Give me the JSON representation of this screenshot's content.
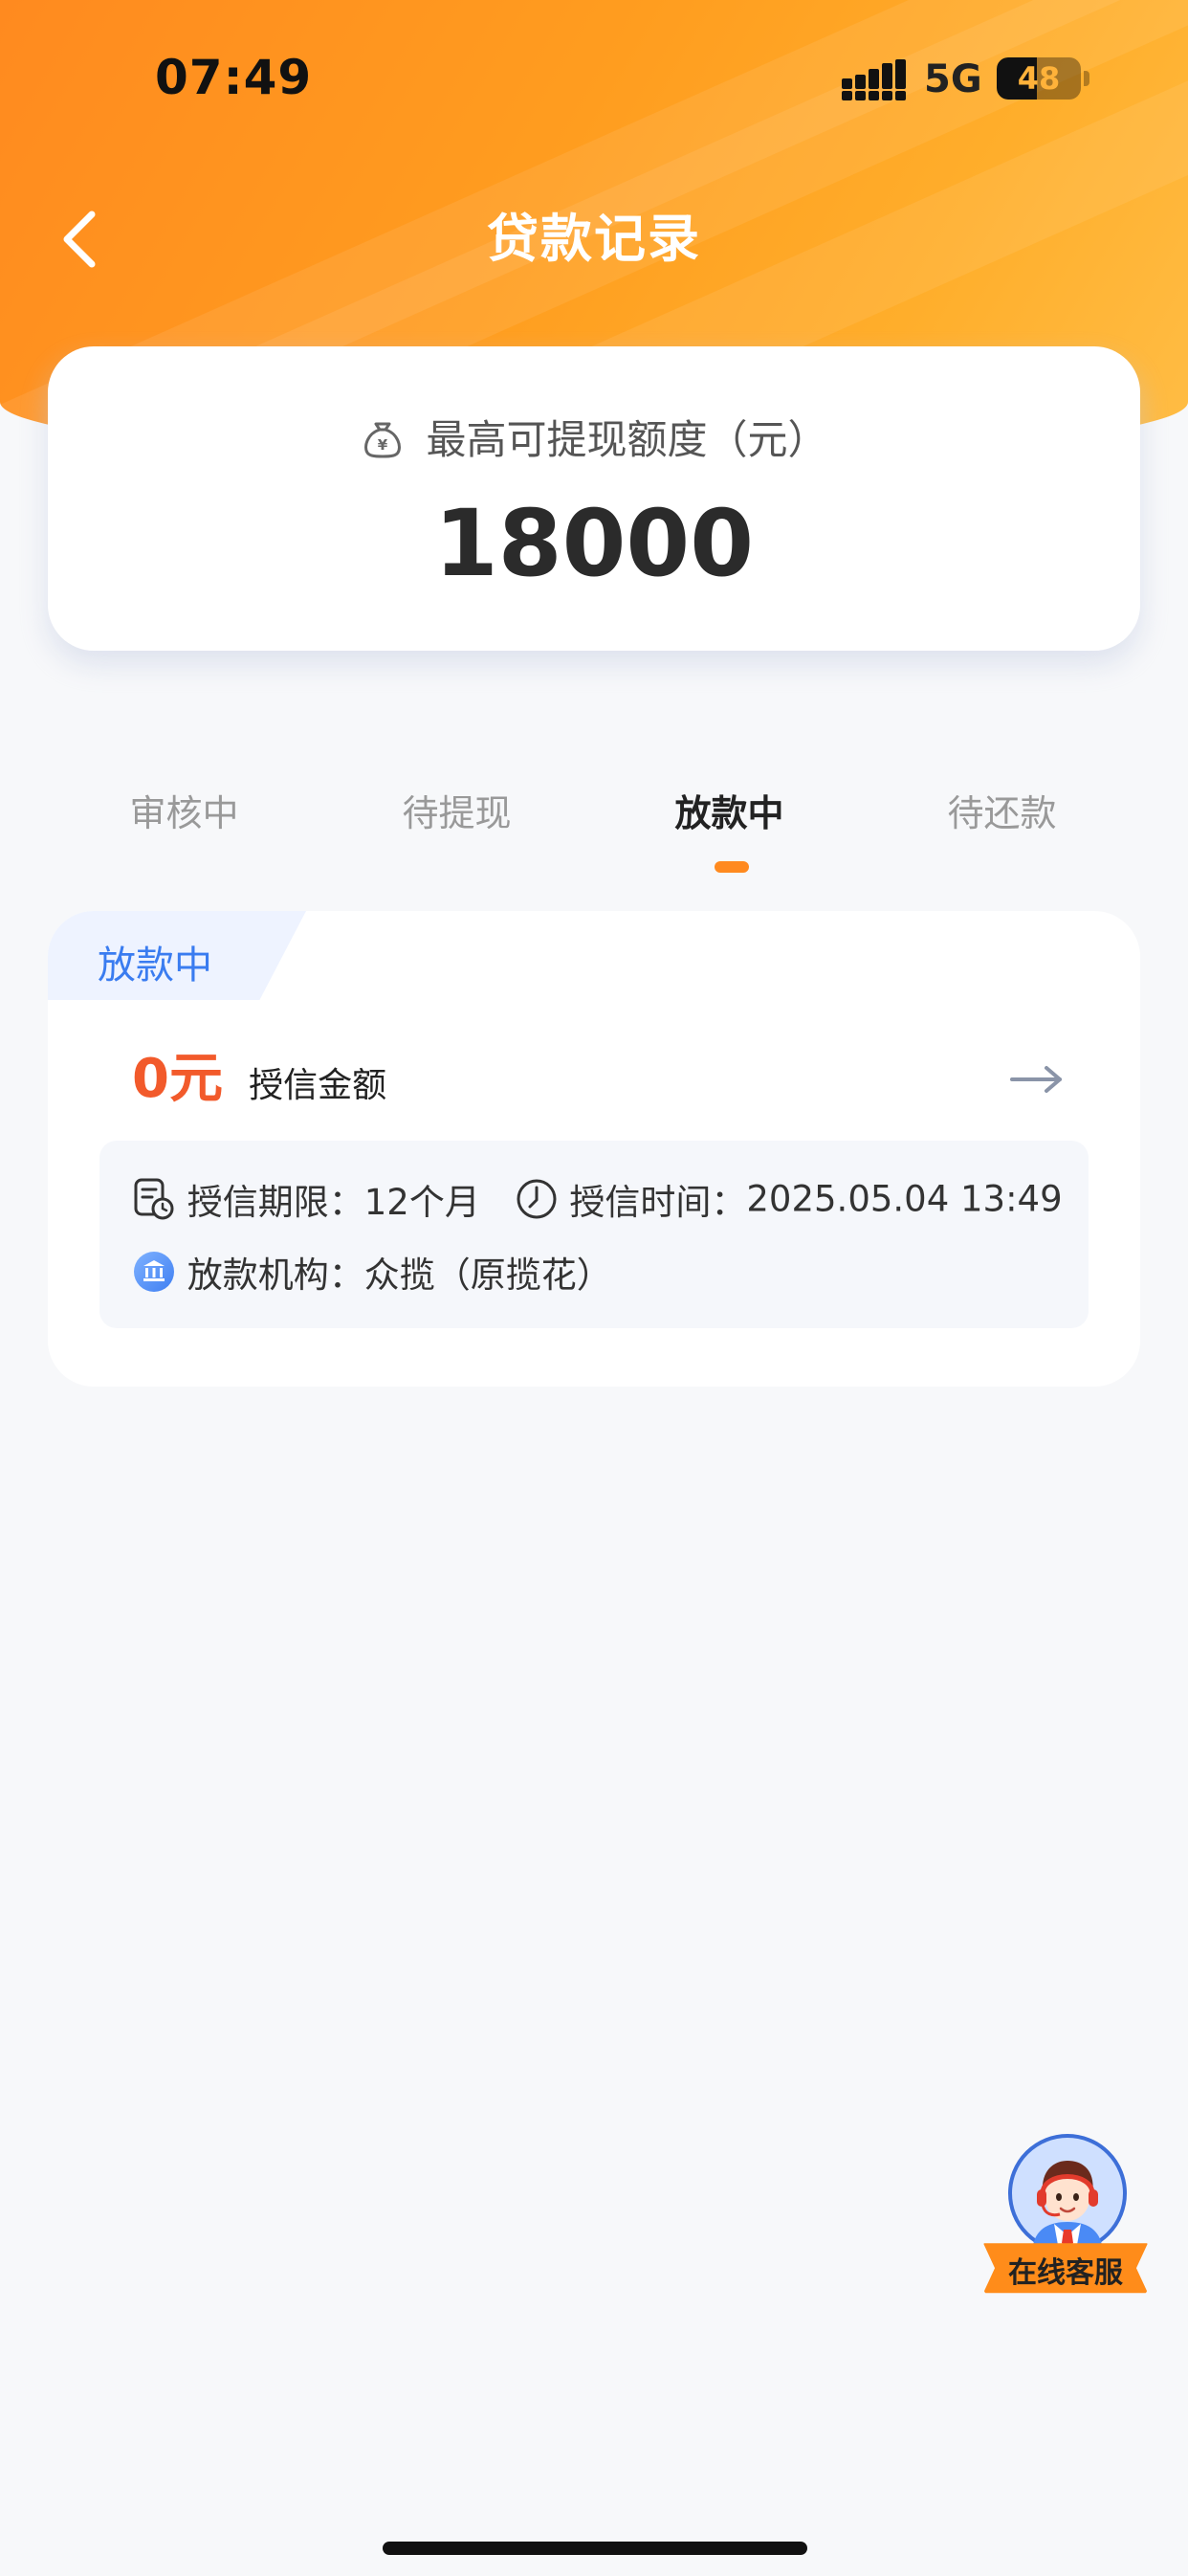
{
  "status_bar": {
    "time": "07:49",
    "network": "5G",
    "battery_level": "48",
    "battery_fraction": 0.48
  },
  "nav": {
    "title": "贷款记录",
    "back_icon": "chevron-left-icon"
  },
  "quota": {
    "label": "最高可提现额度（元）",
    "value": "18000",
    "icon": "moneybag-icon"
  },
  "tabs": [
    {
      "label": "审核中",
      "active": false
    },
    {
      "label": "待提现",
      "active": false
    },
    {
      "label": "放款中",
      "active": true
    },
    {
      "label": "待还款",
      "active": false
    }
  ],
  "record": {
    "status": "放款中",
    "amount": "0元",
    "amount_label": "授信金额",
    "term_label": "授信期限：",
    "term_value": "12个月",
    "time_label": "授信时间：",
    "time_value": "2025.05.04 13:49",
    "institution_label": "放款机构：",
    "institution_value": "众揽（原揽花）"
  },
  "customer_service": {
    "label": "在线客服",
    "icon": "agent-avatar-icon"
  },
  "colors": {
    "brand_orange": "#ff8a1f",
    "amount_red": "#f25a2b",
    "tag_blue": "#3a7cf0",
    "page_bg": "#f7f8fa"
  }
}
